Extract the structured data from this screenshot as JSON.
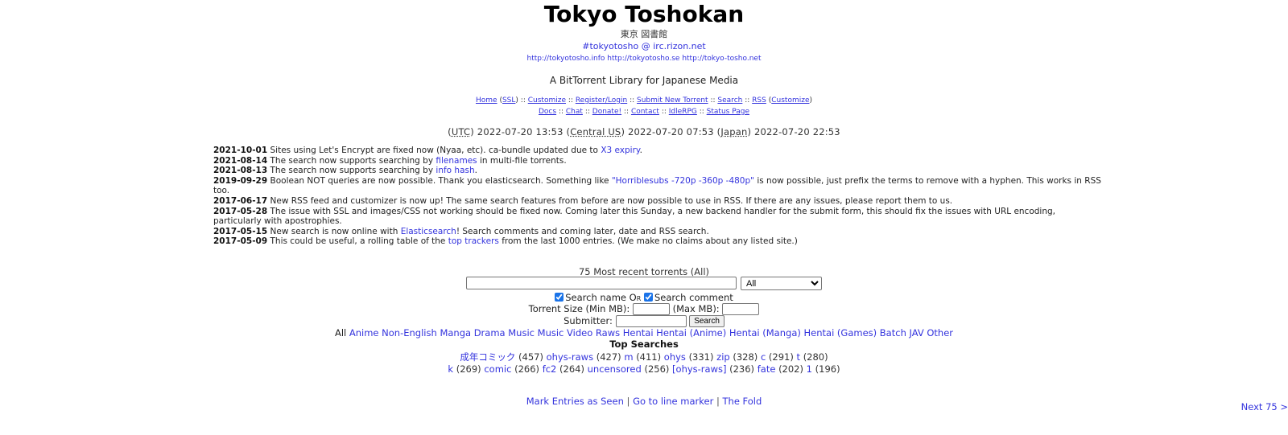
{
  "header": {
    "title": "Tokyo Toshokan",
    "subtitle_jp": "東京 図書館",
    "irc": "#tokyotosho @ irc.rizon.net",
    "mirrors": [
      "http://tokyotosho.info",
      "http://tokyotosho.se",
      "http://tokyo-tosho.net"
    ],
    "tagline": "A BitTorrent Library for Japanese Media"
  },
  "nav": {
    "home": "Home",
    "ssl": "SSL",
    "customize": "Customize",
    "register": "Register/Login",
    "submit": "Submit New Torrent",
    "search": "Search",
    "rss": "RSS",
    "rss_customize": "Customize",
    "docs": "Docs",
    "chat": "Chat",
    "donate": "Donate!",
    "contact": "Contact",
    "idlerpg": "IdleRPG",
    "status": "Status Page",
    "sep": "::"
  },
  "times": {
    "utc_label": "UTC",
    "utc_time": "2022-07-20 13:53",
    "central_label": "Central US",
    "central_time": "2022-07-20 07:53",
    "japan_label": "Japan",
    "japan_time": "2022-07-20 22:53"
  },
  "news": [
    {
      "date": "2021-10-01",
      "pre": "Sites using Let's Encrypt are fixed now (Nyaa, etc). ca-bundle updated due to ",
      "link": "X3 expiry",
      "post": "."
    },
    {
      "date": "2021-08-14",
      "pre": "The search now supports searching by ",
      "link": "filenames",
      "post": " in multi-file torrents."
    },
    {
      "date": "2021-08-13",
      "pre": "The search now supports searching by ",
      "link": "info hash",
      "post": "."
    },
    {
      "date": "2019-09-29",
      "pre": "Boolean NOT queries are now possible. Thank you elasticsearch. Something like ",
      "link": "\"Horriblesubs -720p -360p -480p\"",
      "post": " is now possible, just prefix the terms to remove with a hyphen. This works in RSS too."
    },
    {
      "date": "2017-06-17",
      "pre": "New RSS feed and customizer is now up! The same search features from before are now possible to use in RSS. If there are any issues, please report them to us.",
      "link": "",
      "post": ""
    },
    {
      "date": "2017-05-28",
      "pre": "The issue with SSL and images/CSS not working should be fixed now. Coming later this Sunday, a new backend handler for the submit form, this should fix the issues with URL encoding, particularly with apostrophies.",
      "link": "",
      "post": ""
    },
    {
      "date": "2017-05-15",
      "pre": "New search is now online with ",
      "link": "Elasticsearch",
      "post": "! Search comments and coming later, date and RSS search."
    },
    {
      "date": "2017-05-09",
      "pre": "This could be useful, a rolling table of the ",
      "link": "top trackers",
      "post": " from the last 1000 entries. (We make no claims about any listed site.)"
    }
  ],
  "search": {
    "recent_label": "75 Most recent torrents (All)",
    "query_value": "",
    "category_selected": "All",
    "search_name_label": "Search name",
    "or_label": "Or",
    "search_comment_label": "Search comment",
    "search_name_checked": true,
    "search_comment_checked": true,
    "min_size_label": "Torrent Size (Min MB):",
    "max_size_label": "(Max MB):",
    "min_size_value": "",
    "max_size_value": "",
    "submitter_label": "Submitter:",
    "submitter_value": "",
    "button_label": "Search"
  },
  "categories": {
    "current": "All",
    "links": [
      "Anime",
      "Non-English",
      "Manga",
      "Drama",
      "Music",
      "Music Video",
      "Raws",
      "Hentai",
      "Hentai (Anime)",
      "Hentai (Manga)",
      "Hentai (Games)",
      "Batch",
      "JAV",
      "Other"
    ]
  },
  "top_searches": {
    "title": "Top Searches",
    "row1": [
      {
        "term": "成年コミック",
        "count": "(457)"
      },
      {
        "term": "ohys-raws",
        "count": "(427)"
      },
      {
        "term": "m",
        "count": "(411)"
      },
      {
        "term": "ohys",
        "count": "(331)"
      },
      {
        "term": "zip",
        "count": "(328)"
      },
      {
        "term": "c",
        "count": "(291)"
      },
      {
        "term": "t",
        "count": "(280)"
      }
    ],
    "row2": [
      {
        "term": "k",
        "count": "(269)"
      },
      {
        "term": "comic",
        "count": "(266)"
      },
      {
        "term": "fc2",
        "count": "(264)"
      },
      {
        "term": "uncensored",
        "count": "(256)"
      },
      {
        "term": "[ohys-raws]",
        "count": "(236)"
      },
      {
        "term": "fate",
        "count": "(202)"
      },
      {
        "term": "1",
        "count": "(196)"
      }
    ]
  },
  "footer": {
    "mark_seen": "Mark Entries as Seen",
    "line_marker": "Go to line marker",
    "the_fold": "The Fold",
    "sep": "|",
    "next": "Next 75 >"
  }
}
